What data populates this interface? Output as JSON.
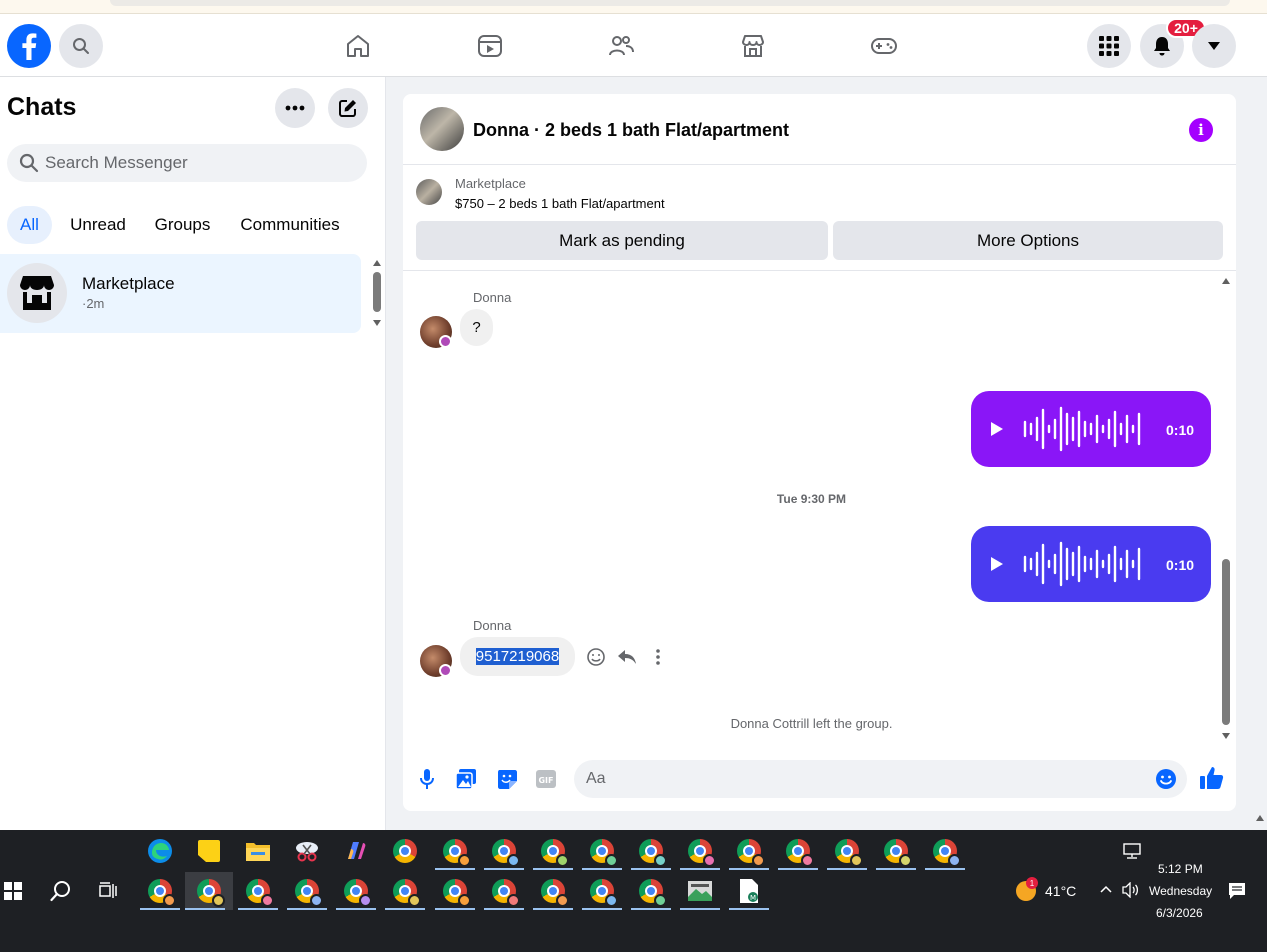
{
  "nav": {
    "notifications_badge": "20+",
    "icons": [
      "facebook-logo",
      "search-icon",
      "home-icon",
      "video-icon",
      "friends-icon",
      "marketplace-icon",
      "gaming-icon",
      "menu-grid-icon",
      "bell-icon",
      "account-caret-icon"
    ]
  },
  "sidebar": {
    "title": "Chats",
    "search_placeholder": "Search Messenger",
    "tabs": [
      {
        "label": "All",
        "active": true
      },
      {
        "label": "Unread",
        "active": false
      },
      {
        "label": "Groups",
        "active": false
      },
      {
        "label": "Communities",
        "active": false
      }
    ],
    "conversations": [
      {
        "name": "Marketplace",
        "time": "·2m"
      }
    ]
  },
  "chat": {
    "title": "Donna · 2 beds 1 bath Flat/apartment",
    "listing": {
      "source": "Marketplace",
      "title": "$750 – 2 beds 1 bath Flat/apartment",
      "buttons": [
        "Mark as pending",
        "More Options"
      ]
    },
    "messages": [
      {
        "sender": "Donna",
        "text": "?"
      },
      {
        "type": "voice",
        "duration": "0:10",
        "color": "#8a16f7"
      },
      {
        "timestamp": "Tue 9:30 PM"
      },
      {
        "type": "voice",
        "duration": "0:10",
        "color": "#4a3bf0"
      },
      {
        "sender": "Donna",
        "text": "9517219068"
      },
      {
        "system": "Donna Cottrill left the group."
      }
    ],
    "composer_placeholder": "Aa"
  },
  "taskbar": {
    "weather": "41°C",
    "weather_alert": "1",
    "time": "5:12 PM",
    "day": "Wednesday",
    "date": "6/3/2026"
  },
  "colors": {
    "brand": "#0866ff",
    "voice_1": "#8a16f7",
    "voice_2": "#4a3bf0",
    "badge": "#e41e3f",
    "info": "#a400ff"
  }
}
